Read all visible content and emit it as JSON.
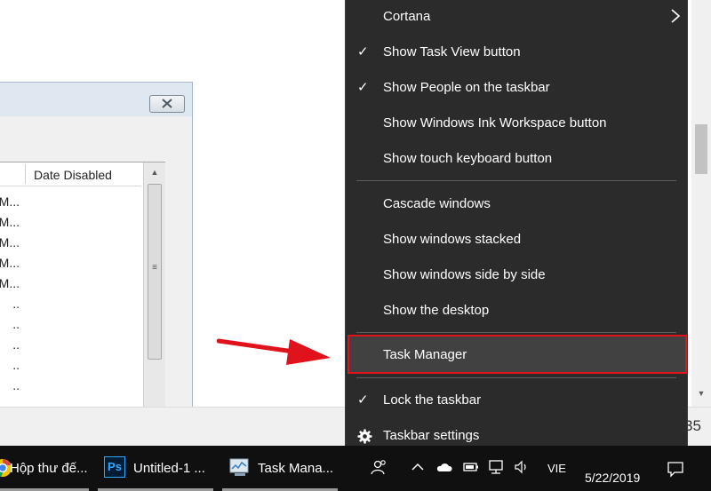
{
  "dialog": {
    "column_header": "Date Disabled",
    "rows": [
      "M...",
      "M...",
      "M...",
      "M...",
      "M...",
      "..",
      "..",
      "..",
      "..",
      ".."
    ]
  },
  "partial_clock_text": "35",
  "context_menu": {
    "items": [
      {
        "label": "Cortana",
        "checked": false,
        "submenu": true
      },
      {
        "label": "Show Task View button",
        "checked": true
      },
      {
        "label": "Show People on the taskbar",
        "checked": true
      },
      {
        "label": "Show Windows Ink Workspace button",
        "checked": false
      },
      {
        "label": "Show touch keyboard button",
        "checked": false
      },
      {
        "label": "Cascade windows",
        "checked": false
      },
      {
        "label": "Show windows stacked",
        "checked": false
      },
      {
        "label": "Show windows side by side",
        "checked": false
      },
      {
        "label": "Show the desktop",
        "checked": false
      },
      {
        "label": "Task Manager",
        "checked": false,
        "highlighted": true
      },
      {
        "label": "Lock the taskbar",
        "checked": true
      },
      {
        "label": "Taskbar settings",
        "icon": "gear-icon"
      }
    ],
    "check_glyph": "✓",
    "highlight_color": "#e0121b"
  },
  "taskbar": {
    "buttons": [
      {
        "label": "Hộp thư đế...",
        "icon": "chrome-icon"
      },
      {
        "label": "Untitled-1 ...",
        "icon": "photoshop-icon",
        "icon_text": "Ps"
      },
      {
        "label": "Task Mana...",
        "icon": "task-manager-icon"
      }
    ],
    "tray": {
      "language": "VIE",
      "date": "5/22/2019"
    }
  },
  "annotation_arrow_color": "#e0121b"
}
